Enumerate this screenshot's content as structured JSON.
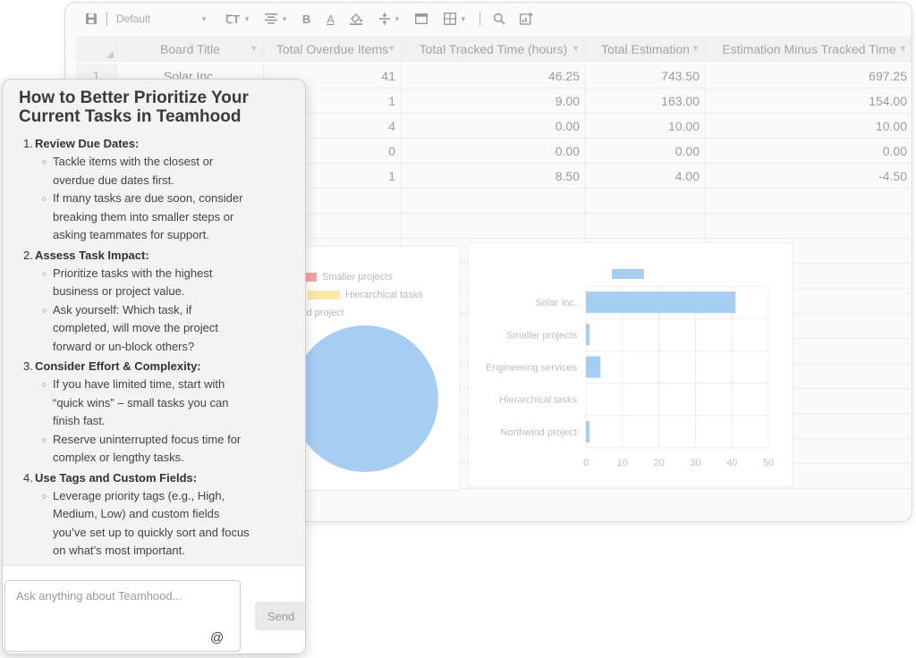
{
  "toolbar": {
    "style_select_value": "Default",
    "icons": [
      "save-icon",
      "font-size-icon",
      "align-icon",
      "bold-icon",
      "font-color-icon",
      "fill-color-icon",
      "valign-icon",
      "merge-icon",
      "borders-icon",
      "search-icon",
      "add-chart-icon"
    ],
    "bold_label": "B",
    "font_color_label": "A",
    "font_size_label": "ꞆT"
  },
  "table": {
    "columns": [
      "Board Title",
      "Total Overdue Items",
      "Total Tracked Time (hours)",
      "Total Estimation",
      "Estimation Minus Tracked Time"
    ],
    "rows": [
      {
        "n": "1",
        "title": "Solar Inc.",
        "overdue": "41",
        "tracked": "46.25",
        "estimation": "743.50",
        "minus": "697.25"
      },
      {
        "n": "",
        "title": "",
        "overdue": "1",
        "tracked": "9.00",
        "estimation": "163.00",
        "minus": "154.00"
      },
      {
        "n": "",
        "title": "",
        "overdue": "4",
        "tracked": "0.00",
        "estimation": "10.00",
        "minus": "10.00"
      },
      {
        "n": "",
        "title": "",
        "overdue": "0",
        "tracked": "0.00",
        "estimation": "0.00",
        "minus": "0.00"
      },
      {
        "n": "",
        "title": "",
        "overdue": "1",
        "tracked": "8.50",
        "estimation": "4.00",
        "minus": "-4.50"
      }
    ]
  },
  "pie_legend": [
    {
      "label": "Smaller projects",
      "color": "#f4a3a3"
    },
    {
      "label": "Hierarchical tasks",
      "color": "#fde9a6"
    },
    {
      "label": "wind project",
      "color": ""
    }
  ],
  "pie_color": "#a8cdf3",
  "chart_data": {
    "type": "bar",
    "orientation": "horizontal",
    "categories": [
      "Solar Inc.",
      "Smaller projects",
      "Engineering services",
      "Hierarchical tasks",
      "Northwind project"
    ],
    "values": [
      41,
      1,
      4,
      0,
      1
    ],
    "xlim": [
      0,
      50
    ],
    "xticks": [
      0,
      10,
      20,
      30,
      40,
      50
    ],
    "grid": true,
    "legend": "top",
    "color": "#a8cdf3"
  },
  "chat": {
    "title": "How to Better Prioritize Your Current Tasks in Teamhood",
    "steps": [
      {
        "num": "1.",
        "heading": "Review Due Dates:",
        "bullets": [
          "Tackle items with the closest or overdue due dates first.",
          "If many tasks are due soon, consider breaking them into smaller steps or asking teammates for support."
        ]
      },
      {
        "num": "2.",
        "heading": "Assess Task Impact:",
        "bullets": [
          "Prioritize tasks with the highest business or project value.",
          "Ask yourself: Which task, if completed, will move the project forward or un-block others?"
        ]
      },
      {
        "num": "3.",
        "heading": "Consider Effort & Complexity:",
        "bullets": [
          "If you have limited time, start with “quick wins” – small tasks you can finish fast.",
          "Reserve uninterrupted focus time for complex or lengthy tasks."
        ]
      },
      {
        "num": "4.",
        "heading": "Use Tags and Custom Fields:",
        "bullets": [
          "Leverage priority tags (e.g., High, Medium, Low) and custom fields you’ve set up to quickly sort and focus on what’s most important."
        ]
      }
    ],
    "input_placeholder": "Ask anything about Teamhood...",
    "send_label": "Send",
    "at_symbol": "@"
  }
}
